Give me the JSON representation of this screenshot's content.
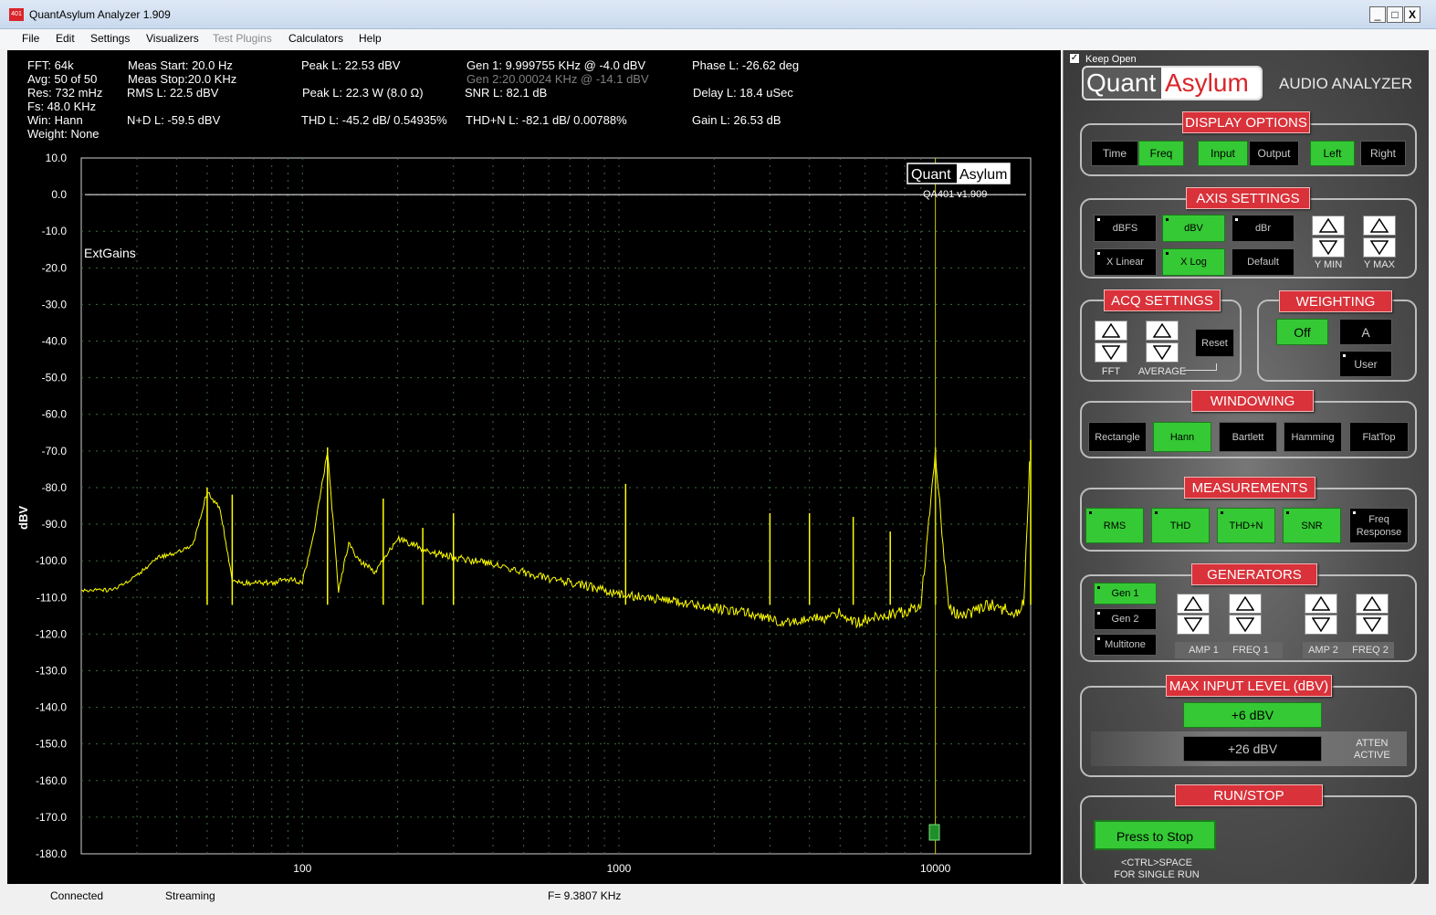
{
  "window": {
    "title": "QuantAsylum Analyzer 1.909",
    "icon_text": "401",
    "min": "_",
    "max": "□",
    "close": "X"
  },
  "menu": [
    "File",
    "Edit",
    "Settings",
    "Visualizers",
    "Test Plugins",
    "Calculators",
    "Help"
  ],
  "stats": {
    "fft": "FFT: 64k",
    "avg": "Avg: 50 of 50",
    "res": "Res: 732 mHz",
    "fs": "Fs: 48.0 KHz",
    "win": "Win: Hann",
    "weight": "Weight: None",
    "meas_start": "Meas Start: 20.0 Hz",
    "meas_stop": "Meas Stop:20.0 KHz",
    "rms": "RMS L: 22.5 dBV",
    "nd": "N+D L: -59.5 dBV",
    "peak1": "Peak L: 22.53 dBV",
    "peak2": "Peak L: 22.3 W (8.0 Ω)",
    "thd": "THD L: -45.2 dB/ 0.54935%",
    "gen1": "Gen 1: 9.999755 KHz @ -4.0  dBV",
    "gen2": "Gen 2:20.00024 KHz @ -14.1  dBV",
    "snr": "SNR L: 82.1 dB",
    "thdn": "THD+N L: -82.1 dB/ 0.00788%",
    "phase": "Phase L: -26.62 deg",
    "delay": "Delay L: 18.4 uSec",
    "gain": "Gain L: 26.53 dB"
  },
  "chart_data": {
    "type": "line",
    "title": "",
    "xlabel": "",
    "ylabel": "dBV",
    "x_scale": "log",
    "xlim": [
      20,
      20000
    ],
    "ylim": [
      -180,
      10
    ],
    "yticks": [
      "10.0",
      "0.0",
      "-10.0",
      "-20.0",
      "-30.0",
      "-40.0",
      "-50.0",
      "-60.0",
      "-70.0",
      "-80.0",
      "-90.0",
      "-100.0",
      "-110.0",
      "-120.0",
      "-130.0",
      "-140.0",
      "-150.0",
      "-160.0",
      "-170.0",
      "-180.0"
    ],
    "xticks": [
      "100",
      "1000",
      "10000"
    ],
    "annotation": "ExtGains",
    "watermark_quant": "Quant",
    "watermark_asylum": "Asylum",
    "watermark_version": "QA401 v1.909",
    "reference_level": 0,
    "grid": true,
    "series": [
      {
        "color": "#ffff00",
        "x": [
          20,
          25,
          30,
          35,
          40,
          45,
          50,
          55,
          60,
          65,
          70,
          80,
          90,
          100,
          110,
          120,
          130,
          140,
          150,
          170,
          200,
          230,
          260,
          300,
          350,
          400,
          500,
          600,
          700,
          800,
          1000,
          1200,
          1500,
          2000,
          2500,
          3000,
          3500,
          4000,
          4500,
          5000,
          5500,
          6000,
          7000,
          8000,
          9000,
          10000,
          11000,
          12000,
          13000,
          14000,
          15000,
          16000,
          17000,
          18000,
          19000,
          20000
        ],
        "y": [
          -108,
          -108,
          -104,
          -99,
          -98,
          -96,
          -81,
          -86,
          -105,
          -106,
          -106,
          -106,
          -105,
          -106,
          -90,
          -70,
          -108,
          -95,
          -100,
          -103,
          -94,
          -96,
          -98,
          -99,
          -100,
          -101,
          -103,
          -105,
          -106,
          -107,
          -109,
          -110,
          -111,
          -113,
          -114,
          -116,
          -117,
          -115,
          -116,
          -114,
          -117,
          -116,
          -115,
          -114,
          -112,
          -70,
          -113,
          -115,
          -114,
          -113,
          -112,
          -114,
          -113,
          -114,
          -112,
          -67
        ]
      }
    ],
    "spikes": [
      {
        "x": 50,
        "y": -80
      },
      {
        "x": 60,
        "y": -82
      },
      {
        "x": 120,
        "y": -69
      },
      {
        "x": 180,
        "y": -83
      },
      {
        "x": 240,
        "y": -91
      },
      {
        "x": 300,
        "y": -87
      },
      {
        "x": 1050,
        "y": -79
      },
      {
        "x": 3000,
        "y": -87
      },
      {
        "x": 4000,
        "y": -87
      },
      {
        "x": 5500,
        "y": -88
      },
      {
        "x": 7200,
        "y": -92
      },
      {
        "x": 10000,
        "y": -69
      },
      {
        "x": 20000,
        "y": -67
      }
    ]
  },
  "panel": {
    "keep_open": "Keep Open",
    "brand_quant": "Quant",
    "brand_asylum": "Asylum",
    "brand_sub": "AUDIO ANALYZER",
    "display_options": {
      "header": "DISPLAY OPTIONS",
      "time": "Time",
      "freq": "Freq",
      "input": "Input",
      "output": "Output",
      "left": "Left",
      "right": "Right"
    },
    "axis_settings": {
      "header": "AXIS SETTINGS",
      "dbfs": "dBFS",
      "dbv": "dBV",
      "dbr": "dBr",
      "xlinear": "X Linear",
      "xlog": "X Log",
      "default": "Default",
      "ymin": "Y MIN",
      "ymax": "Y MAX"
    },
    "acq_settings": {
      "header": "ACQ SETTINGS",
      "fft": "FFT",
      "average": "AVERAGE",
      "reset": "Reset"
    },
    "weighting": {
      "header": "WEIGHTING",
      "off": "Off",
      "a": "A",
      "user": "User"
    },
    "windowing": {
      "header": "WINDOWING",
      "rectangle": "Rectangle",
      "hann": "Hann",
      "bartlett": "Bartlett",
      "hamming": "Hamming",
      "flattop": "FlatTop"
    },
    "measurements": {
      "header": "MEASUREMENTS",
      "rms": "RMS",
      "thd": "THD",
      "thdn": "THD+N",
      "snr": "SNR",
      "freq_response_1": "Freq",
      "freq_response_2": "Response"
    },
    "generators": {
      "header": "GENERATORS",
      "gen1": "Gen 1",
      "gen2": "Gen 2",
      "multitone": "Multitone",
      "amp1": "AMP 1",
      "freq1": "FREQ 1",
      "amp2": "AMP 2",
      "freq2": "FREQ 2"
    },
    "max_input": {
      "header": "MAX INPUT LEVEL (dBV)",
      "level1": "+6 dBV",
      "level2": "+26 dBV",
      "atten1": "ATTEN",
      "atten2": "ACTIVE"
    },
    "run_stop": {
      "header": "RUN/STOP",
      "button": "Press to Stop",
      "hint1": "<CTRL>SPACE",
      "hint2": "FOR SINGLE RUN"
    }
  },
  "status": {
    "connection": "Connected",
    "mode": "Streaming",
    "freq": "F= 9.3807 KHz"
  }
}
